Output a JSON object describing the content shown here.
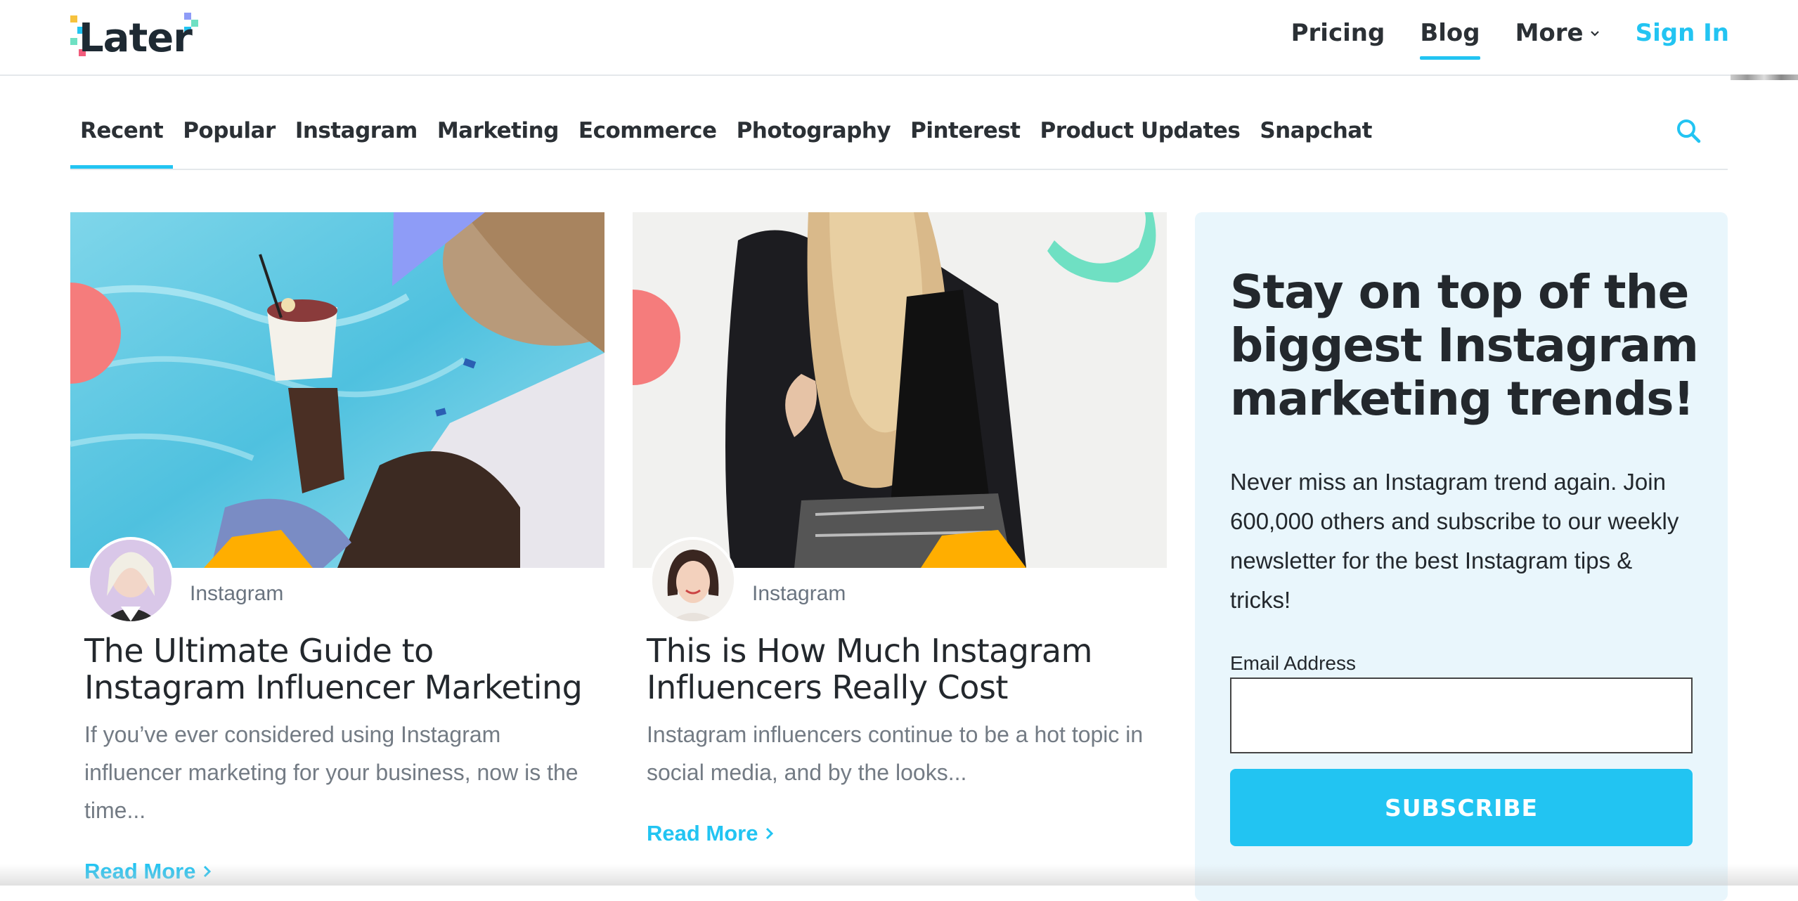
{
  "brand": {
    "name": "Later",
    "accent": "#22c4f2"
  },
  "header": {
    "nav": [
      {
        "label": "Pricing"
      },
      {
        "label": "Blog",
        "active": true
      },
      {
        "label": "More",
        "dropdown": true
      },
      {
        "label": "Sign In"
      }
    ]
  },
  "categories": {
    "tabs": [
      "Recent",
      "Popular",
      "Instagram",
      "Marketing",
      "Ecommerce",
      "Photography",
      "Pinterest",
      "Product Updates",
      "Snapchat"
    ],
    "active": "Recent",
    "search_icon": "search-icon"
  },
  "posts": [
    {
      "category": "Instagram",
      "title": "The Ultimate Guide to Instagram Influencer Marketing",
      "excerpt": "If you’ve ever considered using Instagram influencer marketing for your business, now is the time...",
      "read_more": "Read More"
    },
    {
      "category": "Instagram",
      "title": "This is How Much Instagram Influencers Really Cost",
      "excerpt": "Instagram influencers continue to be a hot topic in social media, and by the looks...",
      "read_more": "Read More"
    }
  ],
  "newsletter": {
    "heading": "Stay on top of the biggest Instagram marketing trends!",
    "description": "Never miss an Instagram trend again. Join 600,000 others and subscribe to our weekly newsletter for the best Instagram tips & tricks!",
    "email_label": "Email Address",
    "email_value": "",
    "button": "SUBSCRIBE"
  }
}
